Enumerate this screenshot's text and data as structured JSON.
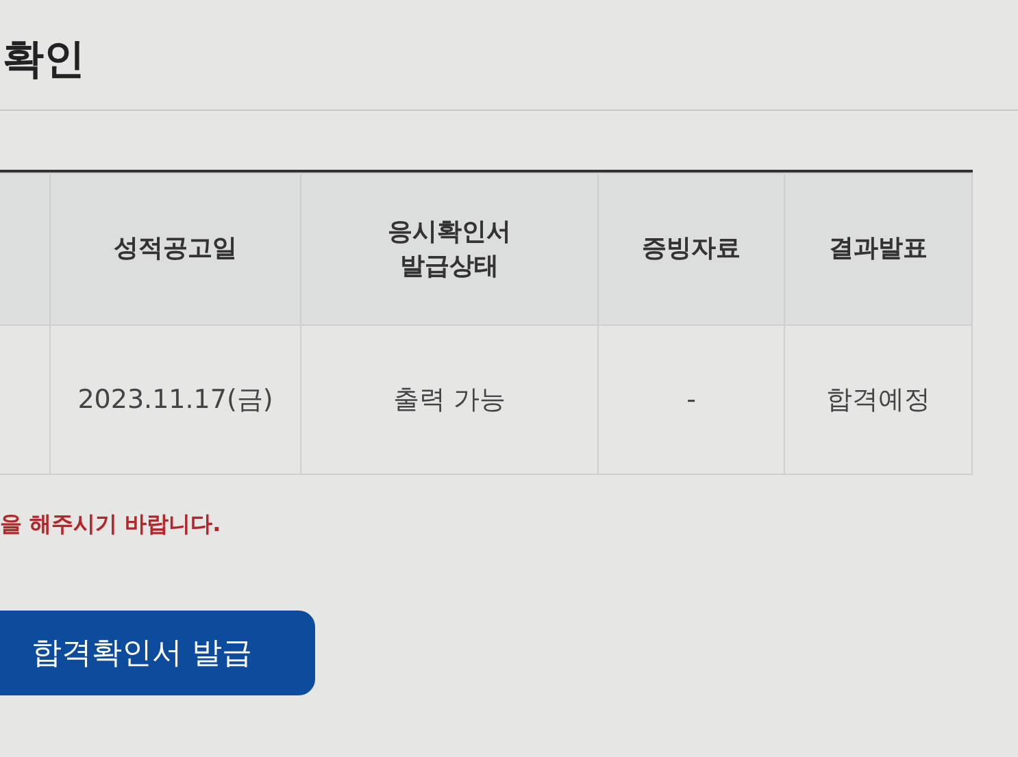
{
  "title": "확인",
  "table": {
    "columns": [
      "",
      "성적공고일",
      "응시확인서\n발급상태",
      "증빙자료",
      "결과발표"
    ],
    "rows": [
      [
        "",
        "2023.11.17(금)",
        "출력 가능",
        "-",
        "합격예정"
      ]
    ]
  },
  "notice": "을 해주시기 바랍니다.",
  "button": "합격확인서 발급"
}
